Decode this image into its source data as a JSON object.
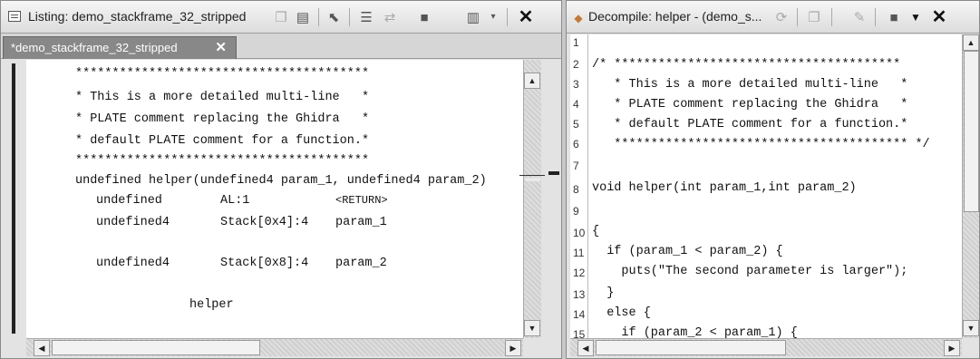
{
  "listing": {
    "title": "Listing:  demo_stackframe_32_stripped",
    "tab_label": "*demo_stackframe_32_stripped",
    "tab_close": "✕",
    "comment_lines": [
      "****************************************",
      "* This is a more detailed multi-line   *",
      "* PLATE comment replacing the Ghidra   *",
      "* default PLATE comment for a function.*",
      "****************************************"
    ],
    "signature": "undefined helper(undefined4 param_1, undefined4 param_2)",
    "vars": [
      {
        "type": "undefined",
        "storage": "AL:1",
        "name": "<RETURN>"
      },
      {
        "type": "undefined4",
        "storage": "Stack[0x4]:4",
        "name": "param_1"
      },
      {
        "type": "undefined4",
        "storage": "Stack[0x8]:4",
        "name": "param_2"
      }
    ],
    "label": "helper"
  },
  "decompile": {
    "title": "Decompile: helper - (demo_s...",
    "line_numbers": [
      "1",
      "2",
      "3",
      "4",
      "5",
      "6",
      "7",
      "8",
      "9",
      "10",
      "11",
      "12",
      "13",
      "14",
      "15"
    ],
    "code_lines": [
      "",
      "/* ***************************************",
      "   * This is a more detailed multi-line   *",
      "   * PLATE comment replacing the Ghidra   *",
      "   * default PLATE comment for a function.*",
      "   **************************************** */",
      "",
      "void helper(int param_1,int param_2)",
      "",
      "{",
      "  if (param_1 < param_2) {",
      "    puts(\"The second parameter is larger\");",
      "  }",
      "  else {",
      "    if (param_2 < param_1) {"
    ]
  },
  "icons": {
    "listing_title": "listing-icon",
    "copy": "copy-icon",
    "paste": "paste-icon",
    "cursor": "cursor-icon",
    "field_edit": "field-editor-icon",
    "diff": "diff-icon",
    "snapshot": "snapshot-icon",
    "layout_menu": "layout-menu-icon",
    "close": "close-icon",
    "refresh": "refresh-icon",
    "export": "export-icon",
    "menu": "menu-icon"
  }
}
